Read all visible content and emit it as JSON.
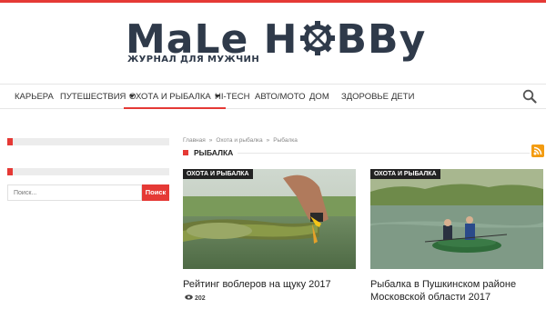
{
  "logo": {
    "text_left": "MaLe H",
    "text_right": "BBy",
    "tagline": "ЖУРНАЛ ДЛЯ МУЖЧИН"
  },
  "nav": {
    "items": [
      {
        "label": "КАРЬЕРА"
      },
      {
        "label": "ПУТЕШЕСТВИЯ"
      },
      {
        "label": "ОХОТА И РЫБАЛКА"
      },
      {
        "label": "HI-TECH"
      },
      {
        "label": "АВТО/МОТО"
      },
      {
        "label": "ДОМ"
      },
      {
        "label": "ЗДОРОВЬЕ"
      },
      {
        "label": "ДЕТИ"
      }
    ],
    "search_icon": "search-icon"
  },
  "sidebar": {
    "search_placeholder": "Поиск...",
    "search_button": "Поиск"
  },
  "breadcrumb": {
    "items": [
      "Главная",
      "Охота и рыбалка",
      "Рыбалка"
    ],
    "separator": "»"
  },
  "section": {
    "title": "РЫБАЛКА",
    "rss_icon": "rss-icon"
  },
  "articles": [
    {
      "tag": "ОХОТА И РЫБАЛКА",
      "title": "Рейтинг воблеров на щуку 2017",
      "views": "202"
    },
    {
      "tag": "ОХОТА И РЫБАЛКА",
      "title": "Рыбалка в Пушкинском районе Московской области 2017"
    }
  ],
  "colors": {
    "accent": "#e53935",
    "logo": "#2f3a4a",
    "rss": "#f39c12"
  }
}
